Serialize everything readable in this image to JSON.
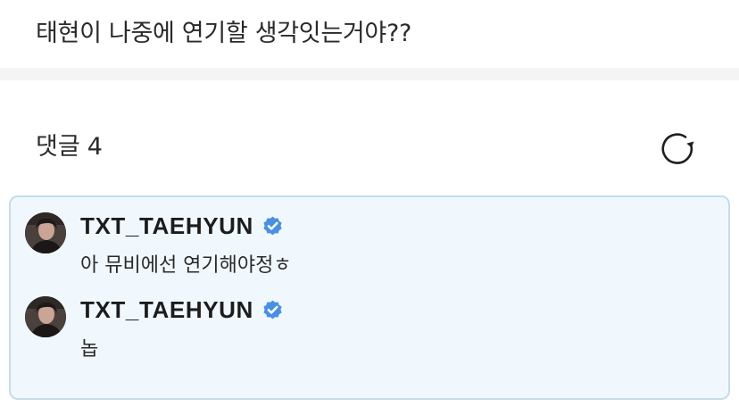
{
  "post": {
    "text": "태현이 나중에 연기할 생각잇는거야??"
  },
  "comments_section": {
    "label": "댓글",
    "count": "4",
    "refresh_icon": "refresh-icon"
  },
  "comments": [
    {
      "author": "TXT_TAEHYUN",
      "verified_icon": "verified-badge-icon",
      "text": "아 뮤비에선 연기해야정ㅎ"
    },
    {
      "author": "TXT_TAEHYUN",
      "verified_icon": "verified-badge-icon",
      "text": "놉"
    }
  ],
  "colors": {
    "comment_highlight_bg": "#f1f8fd",
    "comment_highlight_border": "#c5dcea",
    "verified_blue": "#4a90e2",
    "divider": "#f4f4f5"
  }
}
